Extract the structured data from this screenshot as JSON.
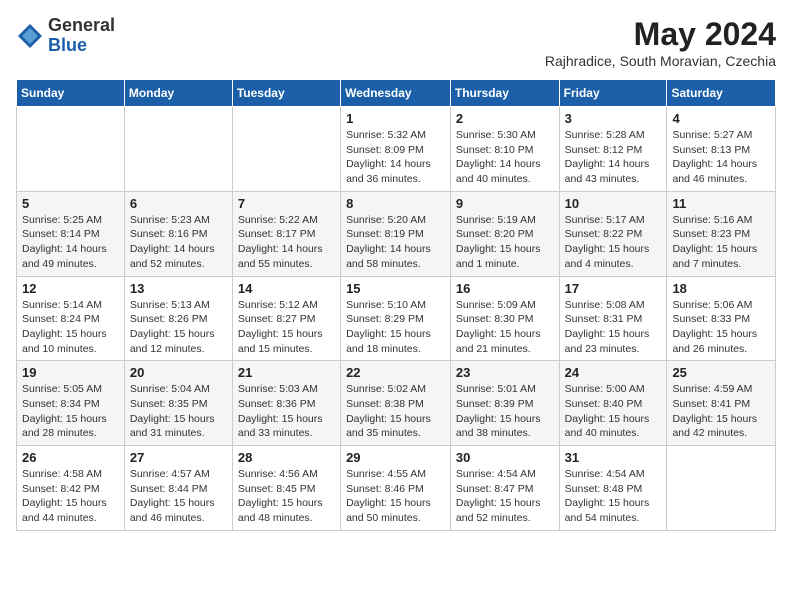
{
  "header": {
    "logo_general": "General",
    "logo_blue": "Blue",
    "month_year": "May 2024",
    "location": "Rajhradice, South Moravian, Czechia"
  },
  "days_of_week": [
    "Sunday",
    "Monday",
    "Tuesday",
    "Wednesday",
    "Thursday",
    "Friday",
    "Saturday"
  ],
  "weeks": [
    [
      {
        "day": "",
        "info": ""
      },
      {
        "day": "",
        "info": ""
      },
      {
        "day": "",
        "info": ""
      },
      {
        "day": "1",
        "info": "Sunrise: 5:32 AM\nSunset: 8:09 PM\nDaylight: 14 hours\nand 36 minutes."
      },
      {
        "day": "2",
        "info": "Sunrise: 5:30 AM\nSunset: 8:10 PM\nDaylight: 14 hours\nand 40 minutes."
      },
      {
        "day": "3",
        "info": "Sunrise: 5:28 AM\nSunset: 8:12 PM\nDaylight: 14 hours\nand 43 minutes."
      },
      {
        "day": "4",
        "info": "Sunrise: 5:27 AM\nSunset: 8:13 PM\nDaylight: 14 hours\nand 46 minutes."
      }
    ],
    [
      {
        "day": "5",
        "info": "Sunrise: 5:25 AM\nSunset: 8:14 PM\nDaylight: 14 hours\nand 49 minutes."
      },
      {
        "day": "6",
        "info": "Sunrise: 5:23 AM\nSunset: 8:16 PM\nDaylight: 14 hours\nand 52 minutes."
      },
      {
        "day": "7",
        "info": "Sunrise: 5:22 AM\nSunset: 8:17 PM\nDaylight: 14 hours\nand 55 minutes."
      },
      {
        "day": "8",
        "info": "Sunrise: 5:20 AM\nSunset: 8:19 PM\nDaylight: 14 hours\nand 58 minutes."
      },
      {
        "day": "9",
        "info": "Sunrise: 5:19 AM\nSunset: 8:20 PM\nDaylight: 15 hours\nand 1 minute."
      },
      {
        "day": "10",
        "info": "Sunrise: 5:17 AM\nSunset: 8:22 PM\nDaylight: 15 hours\nand 4 minutes."
      },
      {
        "day": "11",
        "info": "Sunrise: 5:16 AM\nSunset: 8:23 PM\nDaylight: 15 hours\nand 7 minutes."
      }
    ],
    [
      {
        "day": "12",
        "info": "Sunrise: 5:14 AM\nSunset: 8:24 PM\nDaylight: 15 hours\nand 10 minutes."
      },
      {
        "day": "13",
        "info": "Sunrise: 5:13 AM\nSunset: 8:26 PM\nDaylight: 15 hours\nand 12 minutes."
      },
      {
        "day": "14",
        "info": "Sunrise: 5:12 AM\nSunset: 8:27 PM\nDaylight: 15 hours\nand 15 minutes."
      },
      {
        "day": "15",
        "info": "Sunrise: 5:10 AM\nSunset: 8:29 PM\nDaylight: 15 hours\nand 18 minutes."
      },
      {
        "day": "16",
        "info": "Sunrise: 5:09 AM\nSunset: 8:30 PM\nDaylight: 15 hours\nand 21 minutes."
      },
      {
        "day": "17",
        "info": "Sunrise: 5:08 AM\nSunset: 8:31 PM\nDaylight: 15 hours\nand 23 minutes."
      },
      {
        "day": "18",
        "info": "Sunrise: 5:06 AM\nSunset: 8:33 PM\nDaylight: 15 hours\nand 26 minutes."
      }
    ],
    [
      {
        "day": "19",
        "info": "Sunrise: 5:05 AM\nSunset: 8:34 PM\nDaylight: 15 hours\nand 28 minutes."
      },
      {
        "day": "20",
        "info": "Sunrise: 5:04 AM\nSunset: 8:35 PM\nDaylight: 15 hours\nand 31 minutes."
      },
      {
        "day": "21",
        "info": "Sunrise: 5:03 AM\nSunset: 8:36 PM\nDaylight: 15 hours\nand 33 minutes."
      },
      {
        "day": "22",
        "info": "Sunrise: 5:02 AM\nSunset: 8:38 PM\nDaylight: 15 hours\nand 35 minutes."
      },
      {
        "day": "23",
        "info": "Sunrise: 5:01 AM\nSunset: 8:39 PM\nDaylight: 15 hours\nand 38 minutes."
      },
      {
        "day": "24",
        "info": "Sunrise: 5:00 AM\nSunset: 8:40 PM\nDaylight: 15 hours\nand 40 minutes."
      },
      {
        "day": "25",
        "info": "Sunrise: 4:59 AM\nSunset: 8:41 PM\nDaylight: 15 hours\nand 42 minutes."
      }
    ],
    [
      {
        "day": "26",
        "info": "Sunrise: 4:58 AM\nSunset: 8:42 PM\nDaylight: 15 hours\nand 44 minutes."
      },
      {
        "day": "27",
        "info": "Sunrise: 4:57 AM\nSunset: 8:44 PM\nDaylight: 15 hours\nand 46 minutes."
      },
      {
        "day": "28",
        "info": "Sunrise: 4:56 AM\nSunset: 8:45 PM\nDaylight: 15 hours\nand 48 minutes."
      },
      {
        "day": "29",
        "info": "Sunrise: 4:55 AM\nSunset: 8:46 PM\nDaylight: 15 hours\nand 50 minutes."
      },
      {
        "day": "30",
        "info": "Sunrise: 4:54 AM\nSunset: 8:47 PM\nDaylight: 15 hours\nand 52 minutes."
      },
      {
        "day": "31",
        "info": "Sunrise: 4:54 AM\nSunset: 8:48 PM\nDaylight: 15 hours\nand 54 minutes."
      },
      {
        "day": "",
        "info": ""
      }
    ]
  ]
}
